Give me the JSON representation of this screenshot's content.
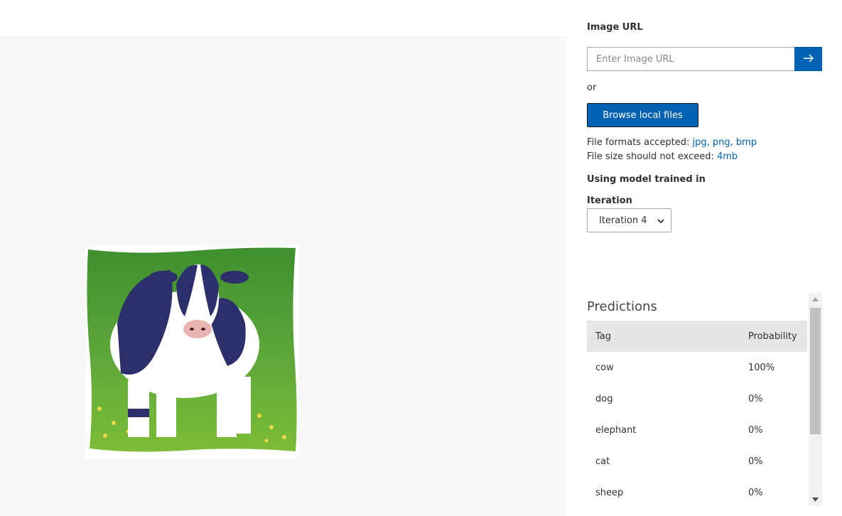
{
  "upload": {
    "image_url_label": "Image URL",
    "image_url_placeholder": "Enter Image URL",
    "submit_icon": "arrow-right-icon",
    "or_text": "or",
    "browse_label": "Browse local files",
    "formats_prefix": "File formats accepted:",
    "formats_value": "jpg, png, bmp",
    "size_prefix": "File size should not exceed:",
    "size_value": "4mb"
  },
  "model": {
    "heading": "Using model trained in",
    "iteration_label": "Iteration",
    "iteration_selected": "Iteration 4"
  },
  "predictions": {
    "title": "Predictions",
    "columns": [
      "Tag",
      "Probability"
    ],
    "rows": [
      {
        "tag": "cow",
        "probability": "100%"
      },
      {
        "tag": "dog",
        "probability": "0%"
      },
      {
        "tag": "elephant",
        "probability": "0%"
      },
      {
        "tag": "cat",
        "probability": "0%"
      },
      {
        "tag": "sheep",
        "probability": "0%"
      }
    ]
  },
  "colors": {
    "accent": "#0062b1",
    "preview_bg": "#f8f8f8",
    "table_header_bg": "#e6e6e6"
  }
}
